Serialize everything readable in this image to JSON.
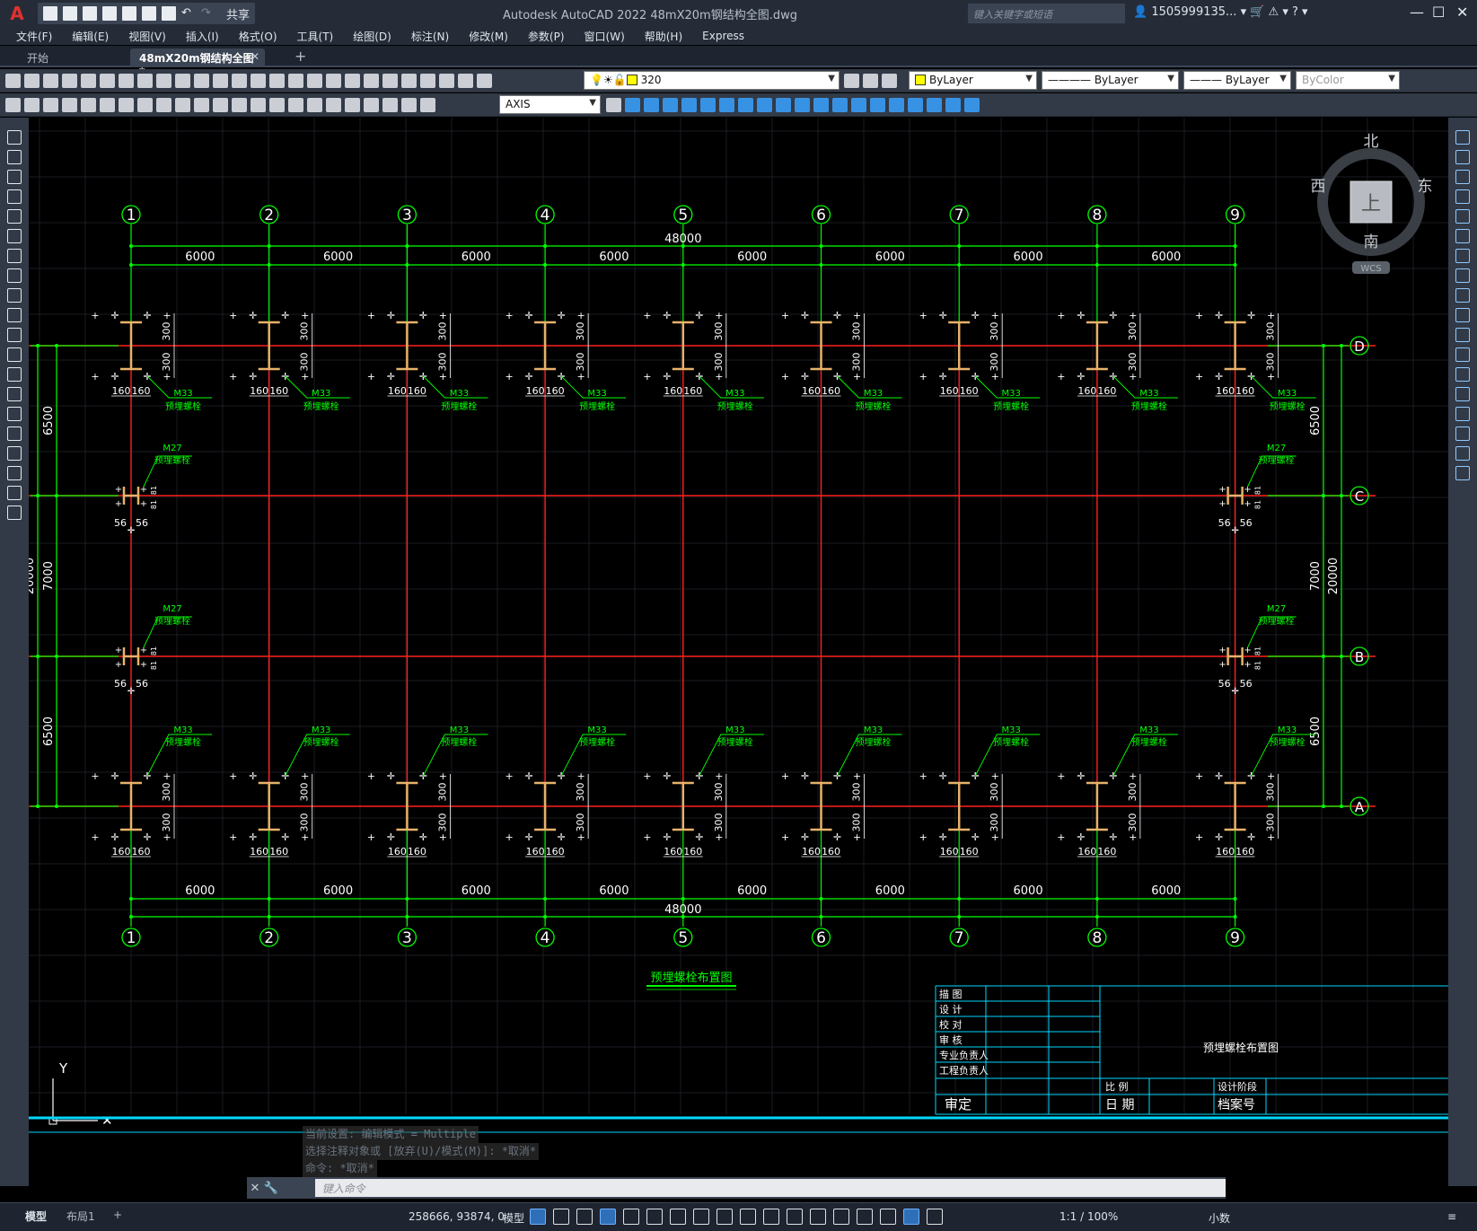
{
  "app": {
    "title": "Autodesk AutoCAD 2022    48mX20m钢结构全图.dwg",
    "share_label": "共享",
    "search_placeholder": "键入关键字或短语",
    "user": "1505999135..."
  },
  "menu": [
    "文件(F)",
    "编辑(E)",
    "视图(V)",
    "插入(I)",
    "格式(O)",
    "工具(T)",
    "绘图(D)",
    "标注(N)",
    "修改(M)",
    "参数(P)",
    "窗口(W)",
    "帮助(H)",
    "Express"
  ],
  "tabs": {
    "start": "开始",
    "active": "48mX20m钢结构全图*"
  },
  "toolbar": {
    "layer": "320",
    "color": "ByLayer",
    "linetype": "ByLayer",
    "lineweight": "ByLayer",
    "plotstyle": "ByColor",
    "dimstyle": "AXIS"
  },
  "viewcube": {
    "north": "北",
    "south": "南",
    "east": "东",
    "west": "西",
    "top": "上",
    "wcs": "WCS"
  },
  "drawing": {
    "axes_x": [
      "1",
      "2",
      "3",
      "4",
      "5",
      "6",
      "7",
      "8",
      "9"
    ],
    "axes_y": [
      "D",
      "C",
      "B",
      "A"
    ],
    "bay": "6000",
    "total_x": "48000",
    "total_y": "20000",
    "dims_y": [
      "6500",
      "7000",
      "6500"
    ],
    "bolt_big": "M33",
    "bolt_small": "M27",
    "bolt_label": "预埋螺栓",
    "d300": "300",
    "d160": "160",
    "d56": "56",
    "d81": "81",
    "plan_title": "预埋螺栓布置图",
    "ucs_y": "Y"
  },
  "titleblock": {
    "rows": [
      "描  图",
      "设  计",
      "校  对",
      "审  核",
      "专业负责人",
      "工程负责人"
    ],
    "approve": "审定",
    "scale_lbl": "比  例",
    "date_lbl": "日  期",
    "phase_lbl": "设计阶段",
    "archive_lbl": "档案号",
    "title": "预埋螺栓布置图"
  },
  "command": {
    "history": [
      "当前设置: 编辑模式 = Multiple",
      "选择注释对象或 [放弃(U)/模式(M)]: *取消*",
      "命令: *取消*"
    ],
    "placeholder": "键入命令"
  },
  "status": {
    "model_tab": "模型",
    "layout_tab": "布局1",
    "coords": "258666, 93874, 0",
    "model": "模型",
    "scale": "1:1 / 100%",
    "units": "小数"
  },
  "colors": {
    "axis": "#00ff00",
    "grid_line": "#ff2020",
    "annotation": "#00ff00",
    "dim_text": "#ffffff",
    "column": "#e8b26a",
    "cyan": "#00d8ff"
  }
}
